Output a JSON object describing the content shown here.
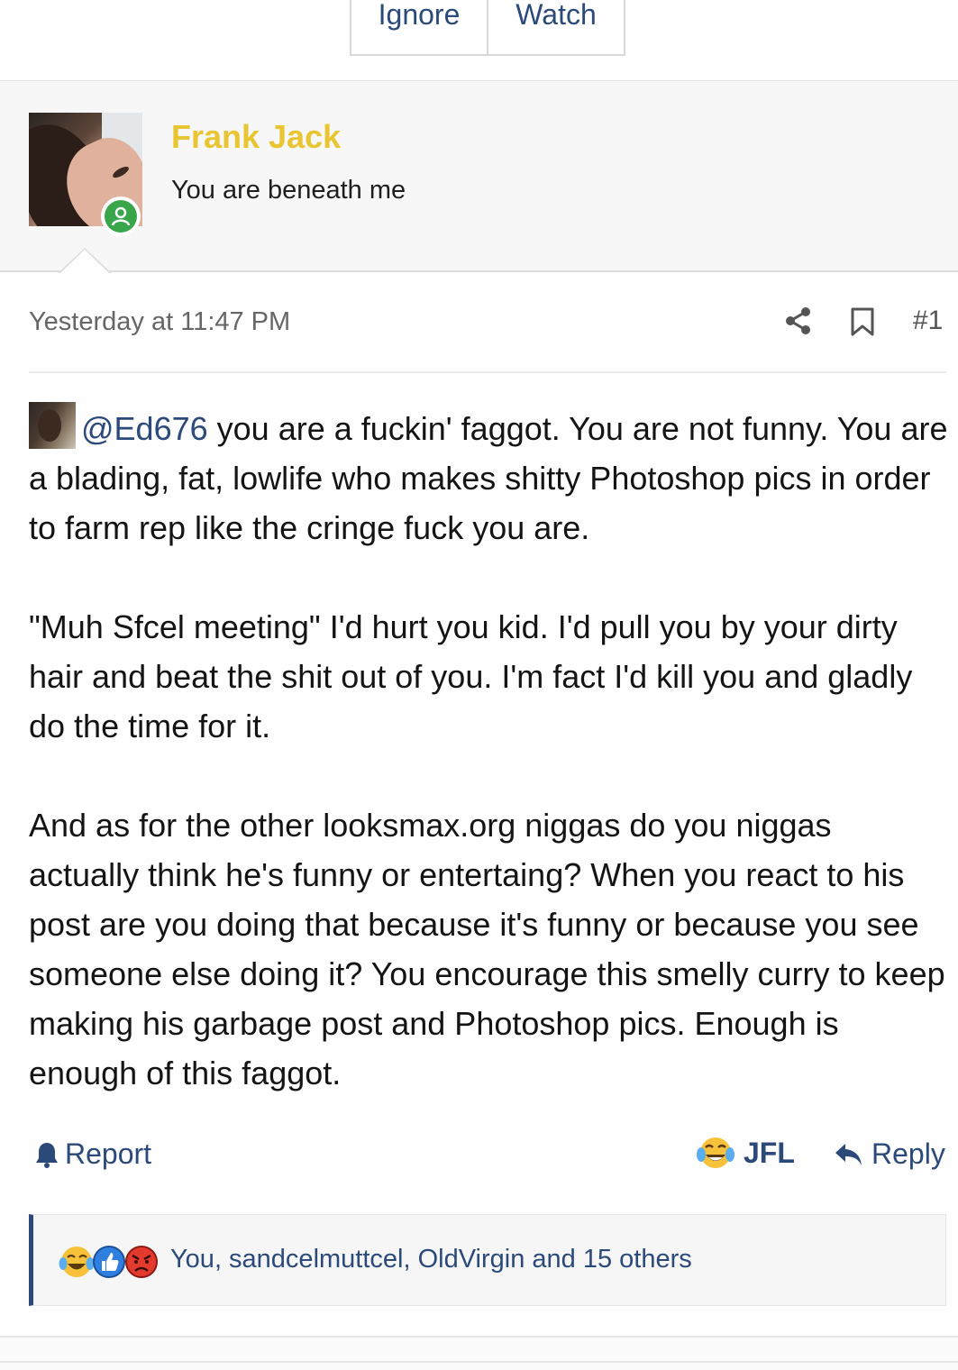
{
  "thread_buttons": {
    "ignore": "Ignore",
    "watch": "Watch"
  },
  "user": {
    "name": "Frank Jack",
    "title": "You are beneath me",
    "name_color": "#e8c531",
    "avatar_icon": "user-avatar-photo",
    "status_icon": "online-user-icon"
  },
  "post": {
    "date": "Yesterday at 11:47 PM",
    "number": "#1",
    "share_icon": "share-icon",
    "bookmark_icon": "bookmark-icon",
    "mention": "@Ed676",
    "p1_after_mention": " you are a fuckin' faggot. You are not funny. You are a blading, fat, lowlife who makes shitty Photoshop pics in order to farm rep like the cringe fuck you are.",
    "p2": "\"Muh Sfcel meeting\" I'd hurt you kid. I'd pull you by your dirty hair and beat the shit out of you. I'm fact I'd kill you and gladly do the time for it.",
    "p3": "And as for the other looksmax.org niggas do you niggas actually think he's funny or entertaing? When you react to his post are you doing that because it's funny or because you see someone else doing it? You encourage this smelly curry to keep making his garbage post and Photoshop pics. Enough is enough of this faggot."
  },
  "actions": {
    "report": "Report",
    "jfl": "JFL",
    "reply": "Reply"
  },
  "reactions": {
    "summary": "You, sandcelmuttcel, OldVirgin and 15 others",
    "icons": [
      "crying-laughing-icon",
      "thumbs-up-icon",
      "angry-face-icon"
    ]
  },
  "colors": {
    "link": "#2b4a7a",
    "online": "#3aa64c"
  }
}
